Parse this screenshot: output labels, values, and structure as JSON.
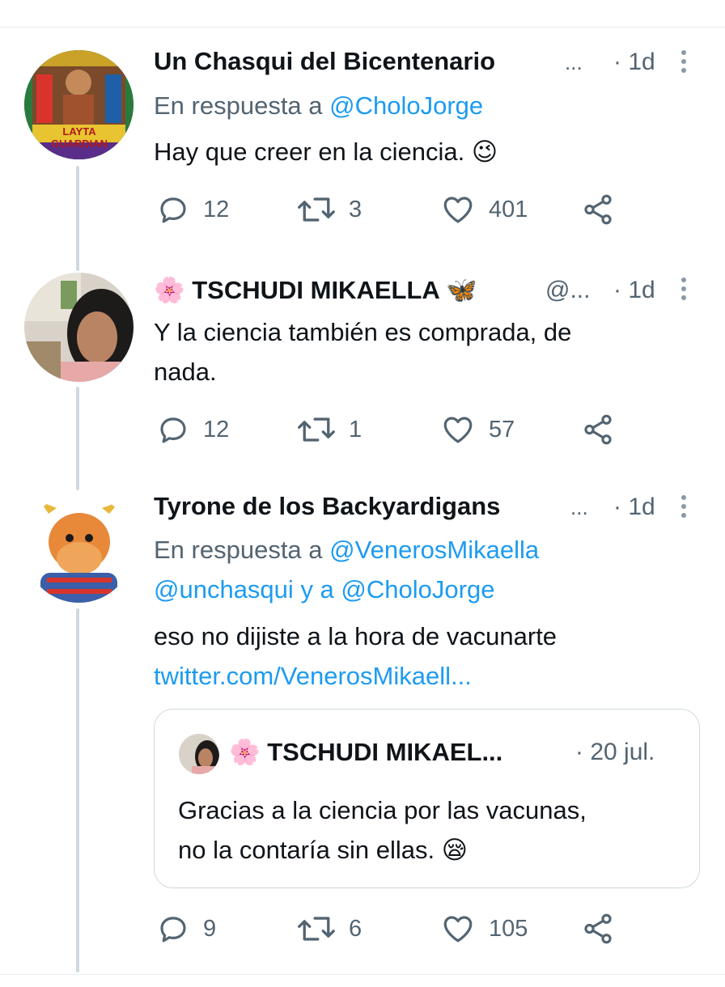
{
  "tweets": [
    {
      "author": "Un Chasqui del Bicentenario",
      "ellipsis": "...",
      "time": "· 1d",
      "reply_prefix": "En respuesta a",
      "reply_to": "@CholoJorge",
      "text": "Hay que creer en la ciencia.",
      "emoji": "😉",
      "avatar_text": "LAYTA GUARDIAN",
      "stats": {
        "replies": "12",
        "retweets": "3",
        "likes": "401"
      }
    },
    {
      "author_prefix_emoji": "🌸",
      "author": "TSCHUDI MIKAELLA",
      "author_suffix_emoji": "🦋",
      "handle": "@...",
      "time": "· 1d",
      "text_line1": "Y la ciencia también es comprada, de",
      "text_line2": "nada.",
      "stats": {
        "replies": "12",
        "retweets": "1",
        "likes": "57"
      }
    },
    {
      "author": "Tyrone de los Backyardigans",
      "ellipsis": "...",
      "time": "· 1d",
      "reply_prefix": "En respuesta a",
      "reply_to_1": "@VenerosMikaella",
      "reply_to_2": "@unchasqui",
      "reply_joiner": "y a",
      "reply_to_3": "@CholoJorge",
      "text": "eso no dijiste a la hora de vacunarte",
      "link": "twitter.com/VenerosMikaell...",
      "quote": {
        "author_prefix_emoji": "🌸",
        "author": "TSCHUDI MIKAEL...",
        "time": "· 20 jul.",
        "text_line1": "Gracias a la ciencia por las vacunas,",
        "text_line2": "no la contaría sin ellas.",
        "emoji": "😪"
      },
      "stats": {
        "replies": "9",
        "retweets": "6",
        "likes": "105"
      }
    }
  ],
  "icons": {
    "reply": "reply-icon",
    "retweet": "retweet-icon",
    "like": "heart-icon",
    "share": "share-icon",
    "more": "more-options-icon"
  },
  "colors": {
    "link": "#1d9bf0",
    "muted": "#536471",
    "border": "#cfd9de"
  }
}
